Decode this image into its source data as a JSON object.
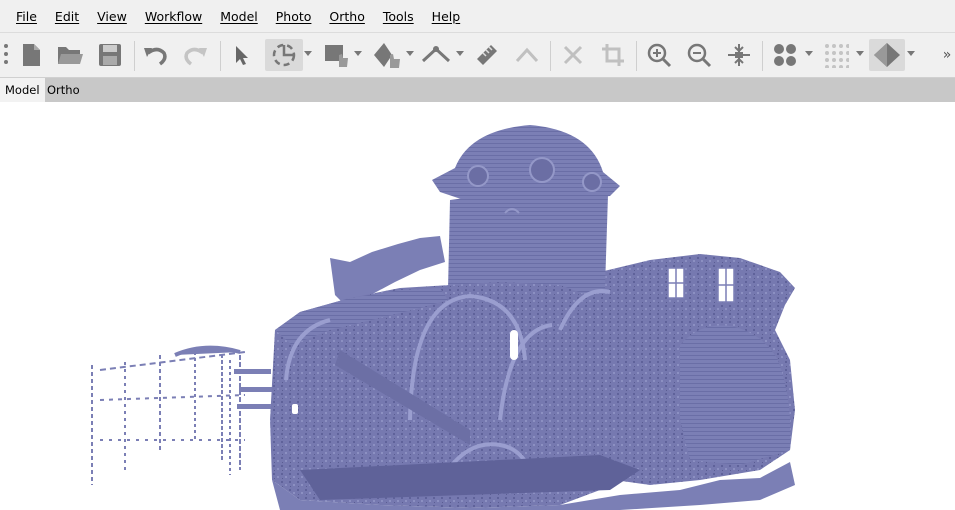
{
  "menu": {
    "items": [
      "File",
      "Edit",
      "View",
      "Workflow",
      "Model",
      "Photo",
      "Ortho",
      "Tools",
      "Help"
    ]
  },
  "toolbar": {
    "overflow_label": "»",
    "icons": [
      "new-document-icon",
      "open-folder-icon",
      "save-icon",
      "undo-icon",
      "redo-icon",
      "pointer-icon",
      "rotate-select-icon",
      "rectangle-selection-icon",
      "draw-polygon-icon",
      "ruler-line-icon",
      "measure-icon",
      "shape-icon",
      "delete-icon",
      "crop-icon",
      "zoom-in-icon",
      "zoom-out-icon",
      "reset-view-icon",
      "points-icon",
      "dense-points-icon",
      "model-shading-icon"
    ]
  },
  "tabs": [
    {
      "label": "Model",
      "active": true
    },
    {
      "label": "Ortho",
      "active": false
    }
  ],
  "viewport": {
    "subject": "3D mesh of church (solid shading)",
    "mesh_color": "#7b7fb5"
  }
}
